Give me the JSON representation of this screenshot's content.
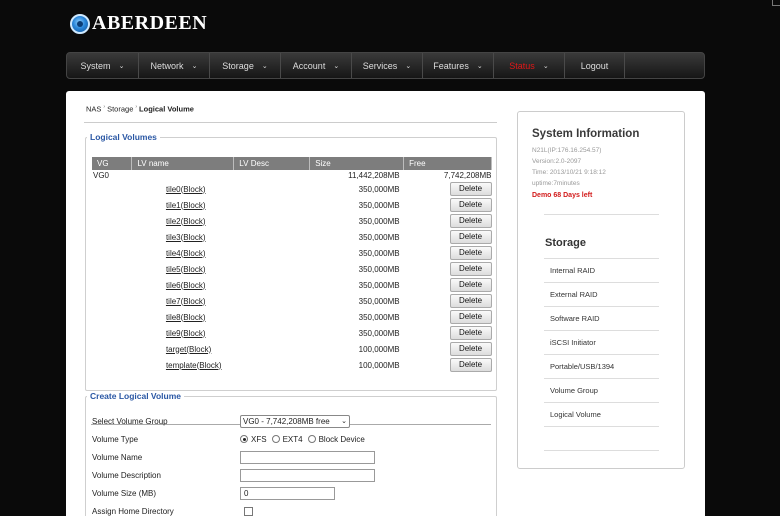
{
  "logo": {
    "text": "ABERDEEN"
  },
  "nav": [
    {
      "label": "System",
      "has_dropdown": true
    },
    {
      "label": "Network",
      "has_dropdown": true
    },
    {
      "label": "Storage",
      "has_dropdown": true
    },
    {
      "label": "Account",
      "has_dropdown": true
    },
    {
      "label": "Services",
      "has_dropdown": true
    },
    {
      "label": "Features",
      "has_dropdown": true
    },
    {
      "label": "Status",
      "has_dropdown": true,
      "active": true
    },
    {
      "label": "Logout",
      "has_dropdown": false
    }
  ],
  "breadcrumb": {
    "items": [
      "NAS",
      "Storage"
    ],
    "current": "Logical Volume",
    "sep": "›"
  },
  "logical_volumes": {
    "legend": "Logical Volumes",
    "columns": [
      "VG",
      "LV name",
      "LV Desc",
      "Size",
      "Free"
    ],
    "vg": {
      "name": "VG0",
      "size": "11,442,208MB",
      "free": "7,742,208MB"
    },
    "delete_label": "Delete",
    "rows": [
      {
        "name": "tile0(Block)",
        "size": "350,000MB"
      },
      {
        "name": "tile1(Block)",
        "size": "350,000MB"
      },
      {
        "name": "tile2(Block)",
        "size": "350,000MB"
      },
      {
        "name": "tile3(Block)",
        "size": "350,000MB"
      },
      {
        "name": "tile4(Block)",
        "size": "350,000MB"
      },
      {
        "name": "tile5(Block)",
        "size": "350,000MB"
      },
      {
        "name": "tile6(Block)",
        "size": "350,000MB"
      },
      {
        "name": "tile7(Block)",
        "size": "350,000MB"
      },
      {
        "name": "tile8(Block)",
        "size": "350,000MB"
      },
      {
        "name": "tile9(Block)",
        "size": "350,000MB"
      },
      {
        "name": "target(Block)",
        "size": "100,000MB"
      },
      {
        "name": "template(Block)",
        "size": "100,000MB"
      }
    ]
  },
  "create_lv": {
    "legend": "Create Logical Volume",
    "select_vg_label": "Select Volume Group",
    "select_vg_value": "VG0 - 7,742,208MB free",
    "volume_type_label": "Volume Type",
    "volume_type_options": [
      "XFS",
      "EXT4",
      "Block Device"
    ],
    "volume_type_selected": "XFS",
    "volume_name_label": "Volume Name",
    "volume_name_value": "",
    "volume_desc_label": "Volume Description",
    "volume_desc_value": "",
    "volume_size_label": "Volume Size (MB)",
    "volume_size_value": "0",
    "assign_home_label": "Assign Home Directory",
    "assign_home_checked": false
  },
  "system_info": {
    "title": "System Information",
    "host": "N21L(IP:176.16.254.57)",
    "version": "Version:2.0-2097",
    "time": "Time: 2013/10/21 9:18:12",
    "uptime": "uptime:7minutes",
    "demo": "Demo 68 Days left"
  },
  "storage_menu": {
    "title": "Storage",
    "items": [
      "Internal RAID",
      "External RAID",
      "Software RAID",
      "iSCSI Initiator",
      "Portable/USB/1394",
      "Volume Group",
      "Logical Volume"
    ]
  },
  "colors": {
    "accent": "#2a57a4",
    "active_nav": "#e01818",
    "demo": "#d21a1a"
  }
}
